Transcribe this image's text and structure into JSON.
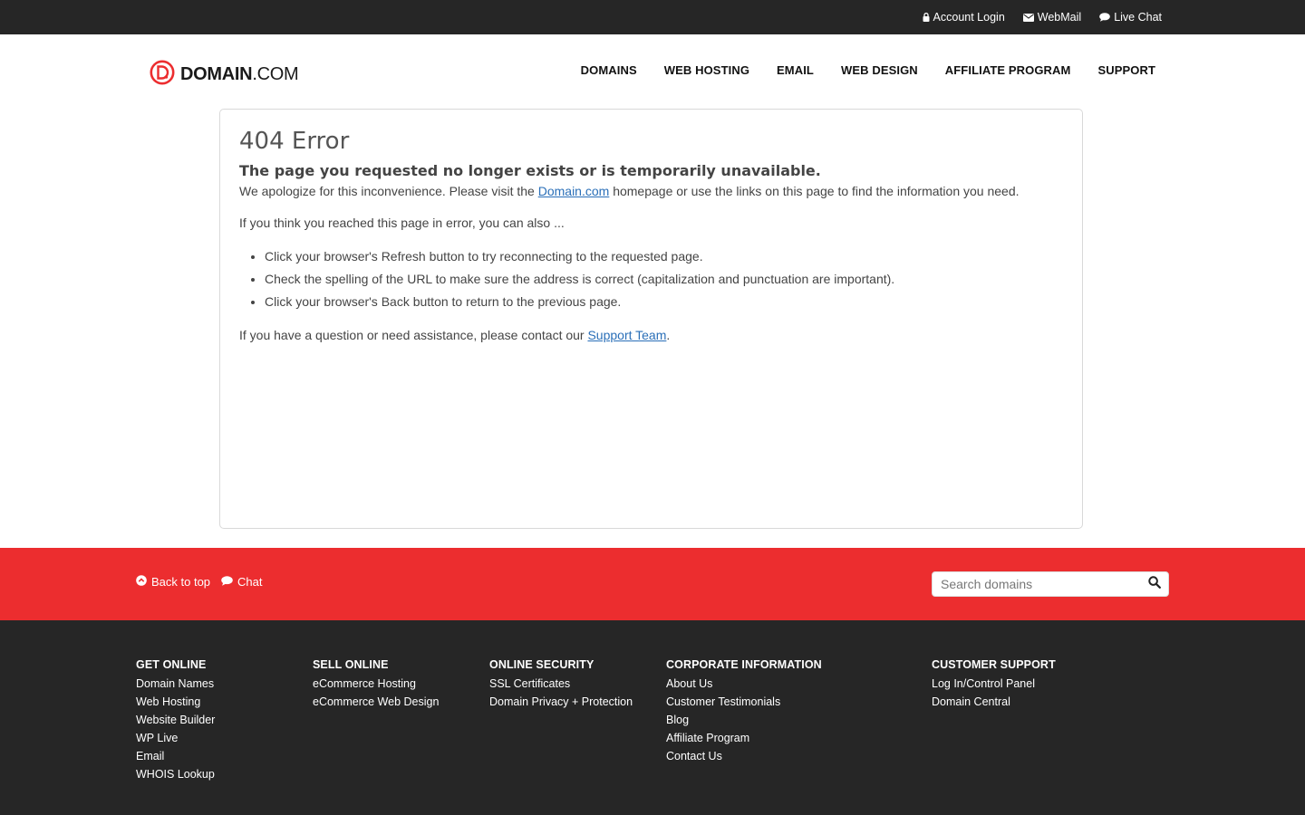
{
  "topbar": {
    "account_login": "Account Login",
    "webmail": "WebMail",
    "live_chat": "Live Chat"
  },
  "logo": {
    "bold": "DOMAIN",
    "light": ".COM"
  },
  "nav": [
    "DOMAINS",
    "WEB HOSTING",
    "EMAIL",
    "WEB DESIGN",
    "AFFILIATE PROGRAM",
    "SUPPORT"
  ],
  "content": {
    "title": "404 Error",
    "subtitle": "The page you requested no longer exists or is temporarily unavailable.",
    "p1_before": "We apologize for this inconvenience. Please visit the ",
    "p1_link": "Domain.com",
    "p1_after": " homepage or use the links on this page to find the information you need.",
    "p2": "If you think you reached this page in error, you can also ...",
    "bullets": [
      "Click your browser's Refresh button to try reconnecting to the requested page.",
      "Check the spelling of the URL to make sure the address is correct (capitalization and punctuation are important).",
      "Click your browser's Back button to return to the previous page."
    ],
    "p3_before": "If you have a question or need assistance, please contact our ",
    "p3_link": "Support Team",
    "p3_after": "."
  },
  "redbar": {
    "back_to_top": "Back to top",
    "chat": "Chat",
    "search_placeholder": "Search domains"
  },
  "footer": {
    "columns": [
      {
        "heading": "GET ONLINE",
        "links": [
          "Domain Names",
          "Web Hosting",
          "Website Builder",
          "WP Live",
          "Email",
          "WHOIS Lookup"
        ]
      },
      {
        "heading": "SELL ONLINE",
        "links": [
          "eCommerce Hosting",
          "eCommerce Web Design"
        ]
      },
      {
        "heading": "ONLINE SECURITY",
        "links": [
          "SSL Certificates",
          "Domain Privacy + Protection"
        ]
      },
      {
        "heading": "CORPORATE INFORMATION",
        "links": [
          "About Us",
          "Customer Testimonials",
          "Blog",
          "Affiliate Program",
          "Contact Us"
        ]
      },
      {
        "heading": "CUSTOMER SUPPORT",
        "links": [
          "Log In/Control Panel",
          "Domain Central"
        ]
      }
    ]
  },
  "colors": {
    "brand_red": "#ec2d2f",
    "dark_bg": "#262626",
    "link_blue": "#2a6fb8"
  },
  "icons": {
    "account_login": "lock-icon",
    "webmail": "envelope-icon",
    "live_chat": "chat-bubble-icon",
    "back_to_top": "circle-chevron-up-icon",
    "chat": "chat-bubble-icon",
    "search": "search-icon"
  }
}
